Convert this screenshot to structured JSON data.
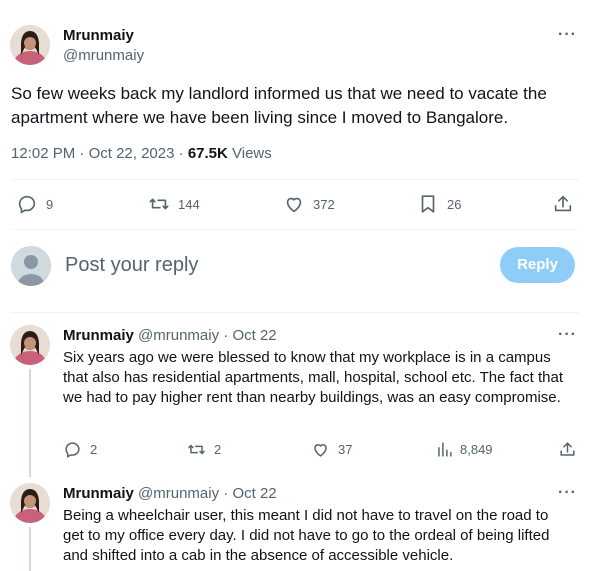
{
  "main_tweet": {
    "author_name": "Mrunmaiy",
    "handle": "@mrunmaiy",
    "text": "So few weeks back my landlord informed us that we need to vacate the apartment where we have been living since I moved to Bangalore.",
    "time": "12:02 PM",
    "date": "Oct 22, 2023",
    "separator": "·",
    "views_count": "67.5K",
    "views_label": "Views",
    "stats": {
      "replies": "9",
      "retweets": "144",
      "likes": "372",
      "bookmarks": "26"
    }
  },
  "reply_box": {
    "placeholder": "Post your reply",
    "button_label": "Reply"
  },
  "replies": [
    {
      "author_name": "Mrunmaiy",
      "handle": "@mrunmaiy",
      "separator": "·",
      "date": "Oct 22",
      "text": "Six years ago we were blessed to know that my workplace is in a campus that also has residential apartments, mall, hospital, school etc. The fact that we had to pay higher rent than nearby buildings, was an easy compromise.",
      "stats": {
        "replies": "2",
        "retweets": "2",
        "likes": "37",
        "views": "8,849"
      }
    },
    {
      "author_name": "Mrunmaiy",
      "handle": "@mrunmaiy",
      "separator": "·",
      "date": "Oct 22",
      "text": "Being a wheelchair user, this meant I did not have to travel on the road to get to my office every day. I did not have to go to the ordeal of being lifted and shifted into a cab in the absence of accessible vehicle."
    }
  ],
  "colors": {
    "text": "#0f1419",
    "muted": "#536471",
    "divider": "#eff3f4",
    "reply_button": "#8ecdf8",
    "thread_line": "#cfd9de"
  },
  "icons": [
    "more-icon",
    "reply-icon",
    "retweet-icon",
    "like-icon",
    "bookmark-icon",
    "share-icon",
    "views-icon",
    "default-avatar-icon"
  ]
}
